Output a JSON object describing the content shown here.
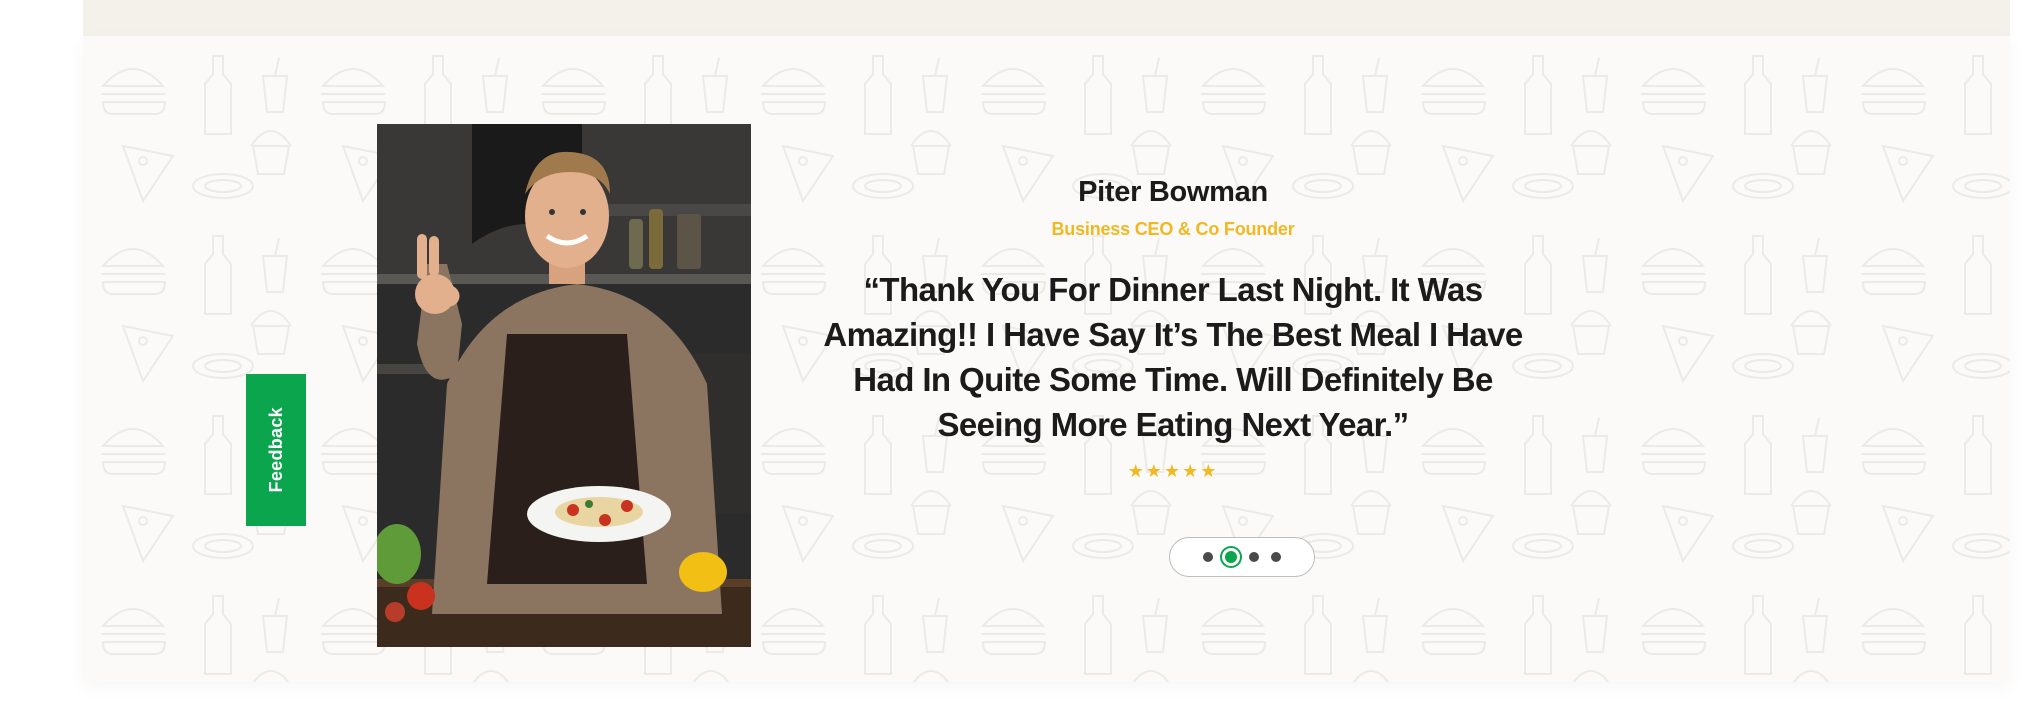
{
  "feedback_tab": {
    "label": "Feedback"
  },
  "testimonial": {
    "name": "Piter Bowman",
    "role": "Business CEO & Co Founder",
    "quote": "“Thank You For Dinner Last Night. It Was Amazing!! I Have Say It’s The Best Meal I Have Had In Quite Some Time. Will Definitely Be Seeing More Eating Next Year.”",
    "rating": 5,
    "stars_text": "★★★★★"
  },
  "pager": {
    "total": 4,
    "active_index": 1
  },
  "colors": {
    "accent_green": "#0aa54c",
    "accent_yellow": "#f2b822",
    "text_dark": "#1b1b1b",
    "top_strip": "#f3f1ea",
    "section_bg": "#fbfaf8"
  },
  "icons": {
    "background_pattern": "food-doodle-pattern",
    "rating": "star-icon"
  }
}
